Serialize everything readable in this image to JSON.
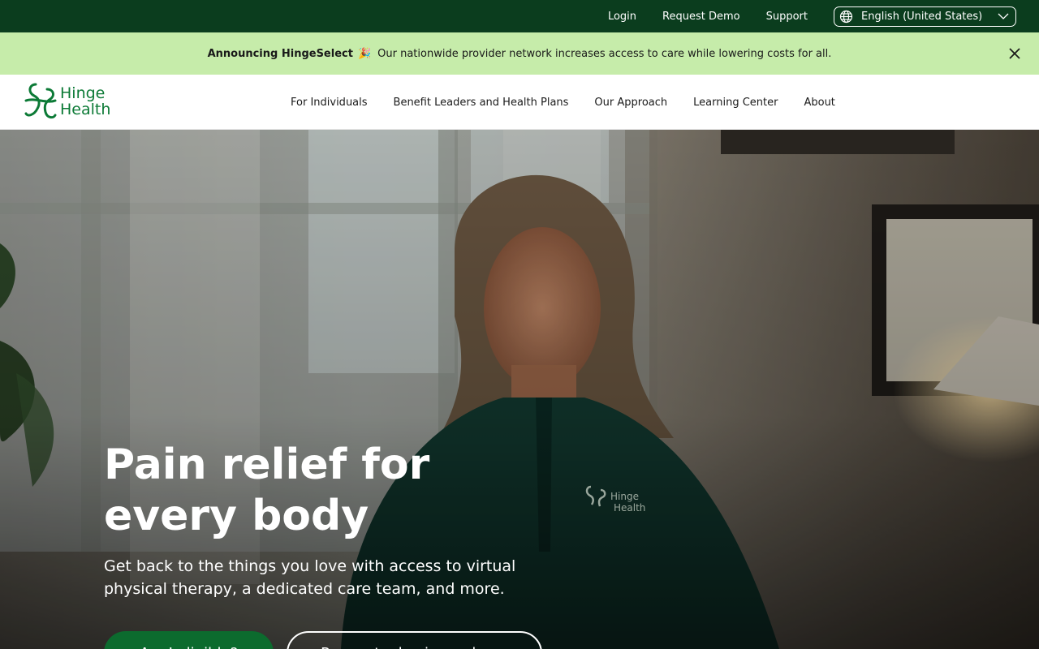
{
  "utility_bar": {
    "links": [
      "Login",
      "Request Demo",
      "Support"
    ],
    "language": "English (United States)"
  },
  "announcement": {
    "title": "Announcing HingeSelect",
    "emoji": "🎉",
    "message": "Our nationwide provider network increases access to care while lowering costs for all."
  },
  "nav": {
    "logo_line1": "Hinge",
    "logo_line2": "Health",
    "items": [
      "For Individuals",
      "Benefit Leaders and Health Plans",
      "Our Approach",
      "Learning Center",
      "About"
    ]
  },
  "hero": {
    "title_line1": "Pain relief for",
    "title_line2": "every body",
    "subtitle_line1": "Get back to the things you love with access to virtual",
    "subtitle_line2": "physical therapy, a dedicated care team, and more.",
    "primary_cta": "Am I eligible?",
    "secondary_cta": "Request a business demo",
    "shirt_logo_line1": "Hinge",
    "shirt_logo_line2": "Health"
  },
  "colors": {
    "utility_bg": "#0b3d1e",
    "announce_bg": "#c6ecaa",
    "brand_green": "#0c7a36",
    "cta_green": "#0c6b2e"
  }
}
